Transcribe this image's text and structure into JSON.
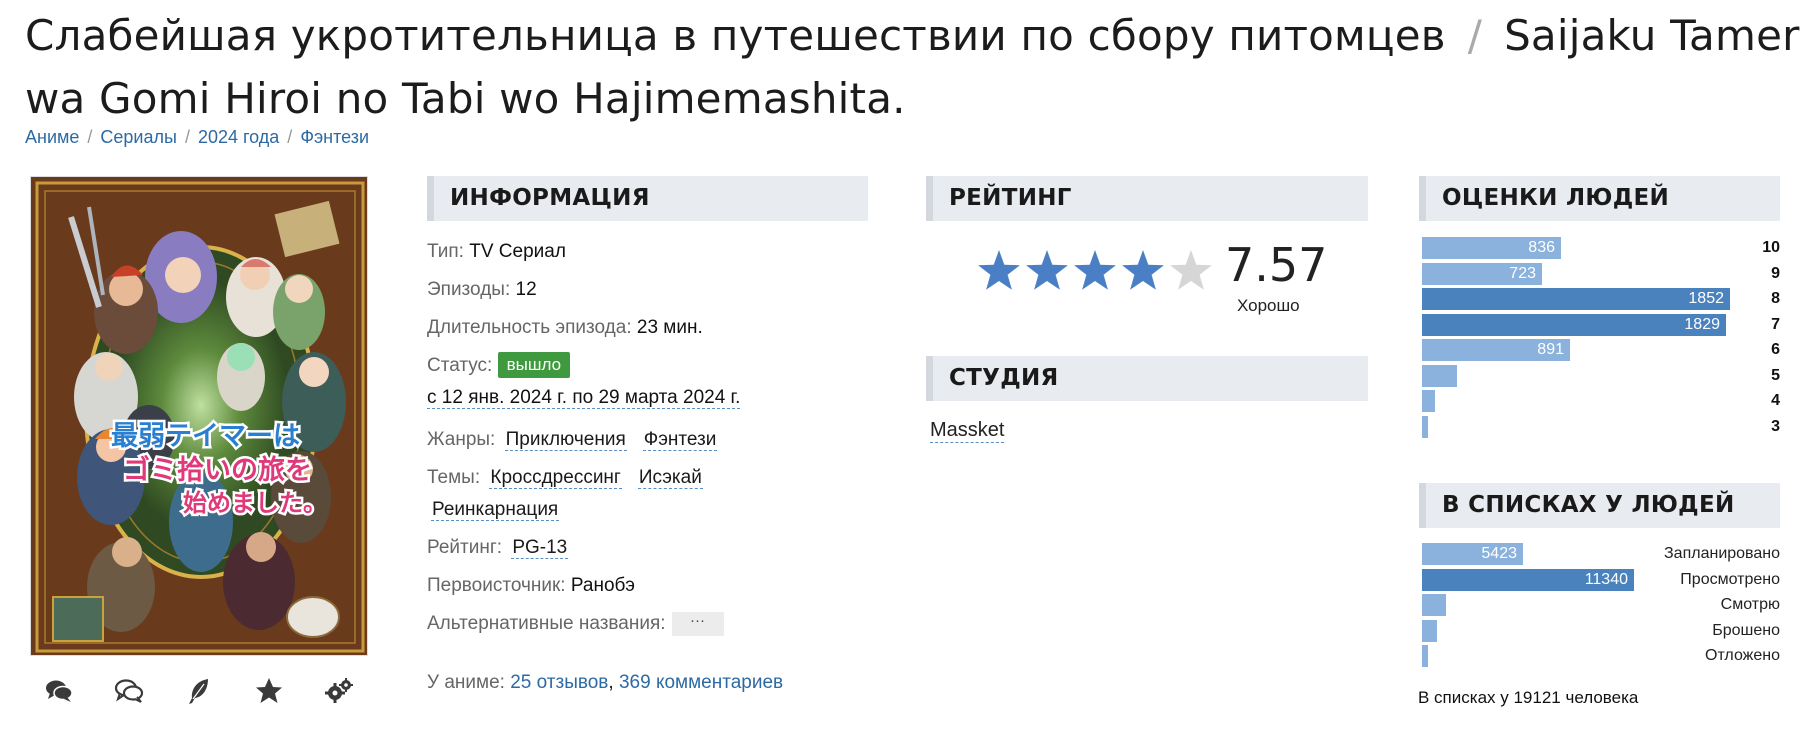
{
  "title": {
    "ru": "Слабейшая укротительница в путешествии по сбору питомцев",
    "slash": "/",
    "romaji": "Saijaku Tamer wa Gomi Hiroi no Tabi wo Hajimemashita."
  },
  "breadcrumbs": [
    "Аниме",
    "Сериалы",
    "2024 года",
    "Фэнтези"
  ],
  "breadcrumb_sep": "/",
  "poster": {
    "logo_line1": "最弱テイマーは",
    "logo_line2": "ゴミ拾いの旅を",
    "logo_line3": "始めました。"
  },
  "actions": [
    "comments-icon",
    "discussion-icon",
    "feather-icon",
    "star-icon",
    "gears-icon"
  ],
  "info": {
    "heading": "ИНФОРМАЦИЯ",
    "type_label": "Тип:",
    "type_value": "TV Сериал",
    "episodes_label": "Эпизоды:",
    "episodes_value": "12",
    "duration_label": "Длительность эпизода:",
    "duration_value": "23 мин.",
    "status_label": "Статус:",
    "status_value": "вышло",
    "aired": "с 12 янв. 2024 г. по 29 марта 2024 г.",
    "genres_label": "Жанры:",
    "genres": [
      "Приключения",
      "Фэнтези"
    ],
    "themes_label": "Темы:",
    "themes": [
      "Кроссдрессинг",
      "Исэкай",
      "Реинкарнация"
    ],
    "rating_label": "Рейтинг:",
    "rating_value": "PG-13",
    "source_label": "Первоисточник:",
    "source_value": "Ранобэ",
    "alt_label": "Альтернативные названия:",
    "alt_button": "···"
  },
  "reviews": {
    "label": "У аниме:",
    "reviews_link": "25 отзывов",
    "comma": ",",
    "comments_link": "369 комментариев"
  },
  "rating": {
    "heading": "РЕЙТИНГ",
    "score": "7.57",
    "word": "Хорошо",
    "stars_filled": 4,
    "stars_total": 5,
    "star_color": "#4a7fc6",
    "star_empty_color": "#d6d6d6"
  },
  "studio": {
    "heading": "СТУДИЯ",
    "name": "Massket"
  },
  "scores": {
    "heading": "ОЦЕНКИ ЛЮДЕЙ",
    "rows": [
      {
        "score": "10",
        "count": "836",
        "value": 836
      },
      {
        "score": "9",
        "count": "723",
        "value": 723
      },
      {
        "score": "8",
        "count": "1852",
        "value": 1852
      },
      {
        "score": "7",
        "count": "1829",
        "value": 1829
      },
      {
        "score": "6",
        "count": "891",
        "value": 891
      },
      {
        "score": "5",
        "count": "",
        "value": 210
      },
      {
        "score": "4",
        "count": "",
        "value": 80
      },
      {
        "score": "3",
        "count": "",
        "value": 30
      }
    ]
  },
  "lists": {
    "heading": "В СПИСКАХ У ЛЮДЕЙ",
    "rows": [
      {
        "label": "Запланировано",
        "count": "5423",
        "value": 5423
      },
      {
        "label": "Просмотрено",
        "count": "11340",
        "value": 11340
      },
      {
        "label": "Смотрю",
        "count": "",
        "value": 1300
      },
      {
        "label": "Брошено",
        "count": "",
        "value": 780
      },
      {
        "label": "Отложено",
        "count": "",
        "value": 240
      }
    ],
    "note": "В списках у 19121 человека"
  },
  "colors": {
    "link": "#2d6aa3",
    "bar_light": "#8ab2dc",
    "bar_dark": "#4a82be",
    "status_badge": "#3f9a3f",
    "section_bg": "#e8ebef"
  }
}
